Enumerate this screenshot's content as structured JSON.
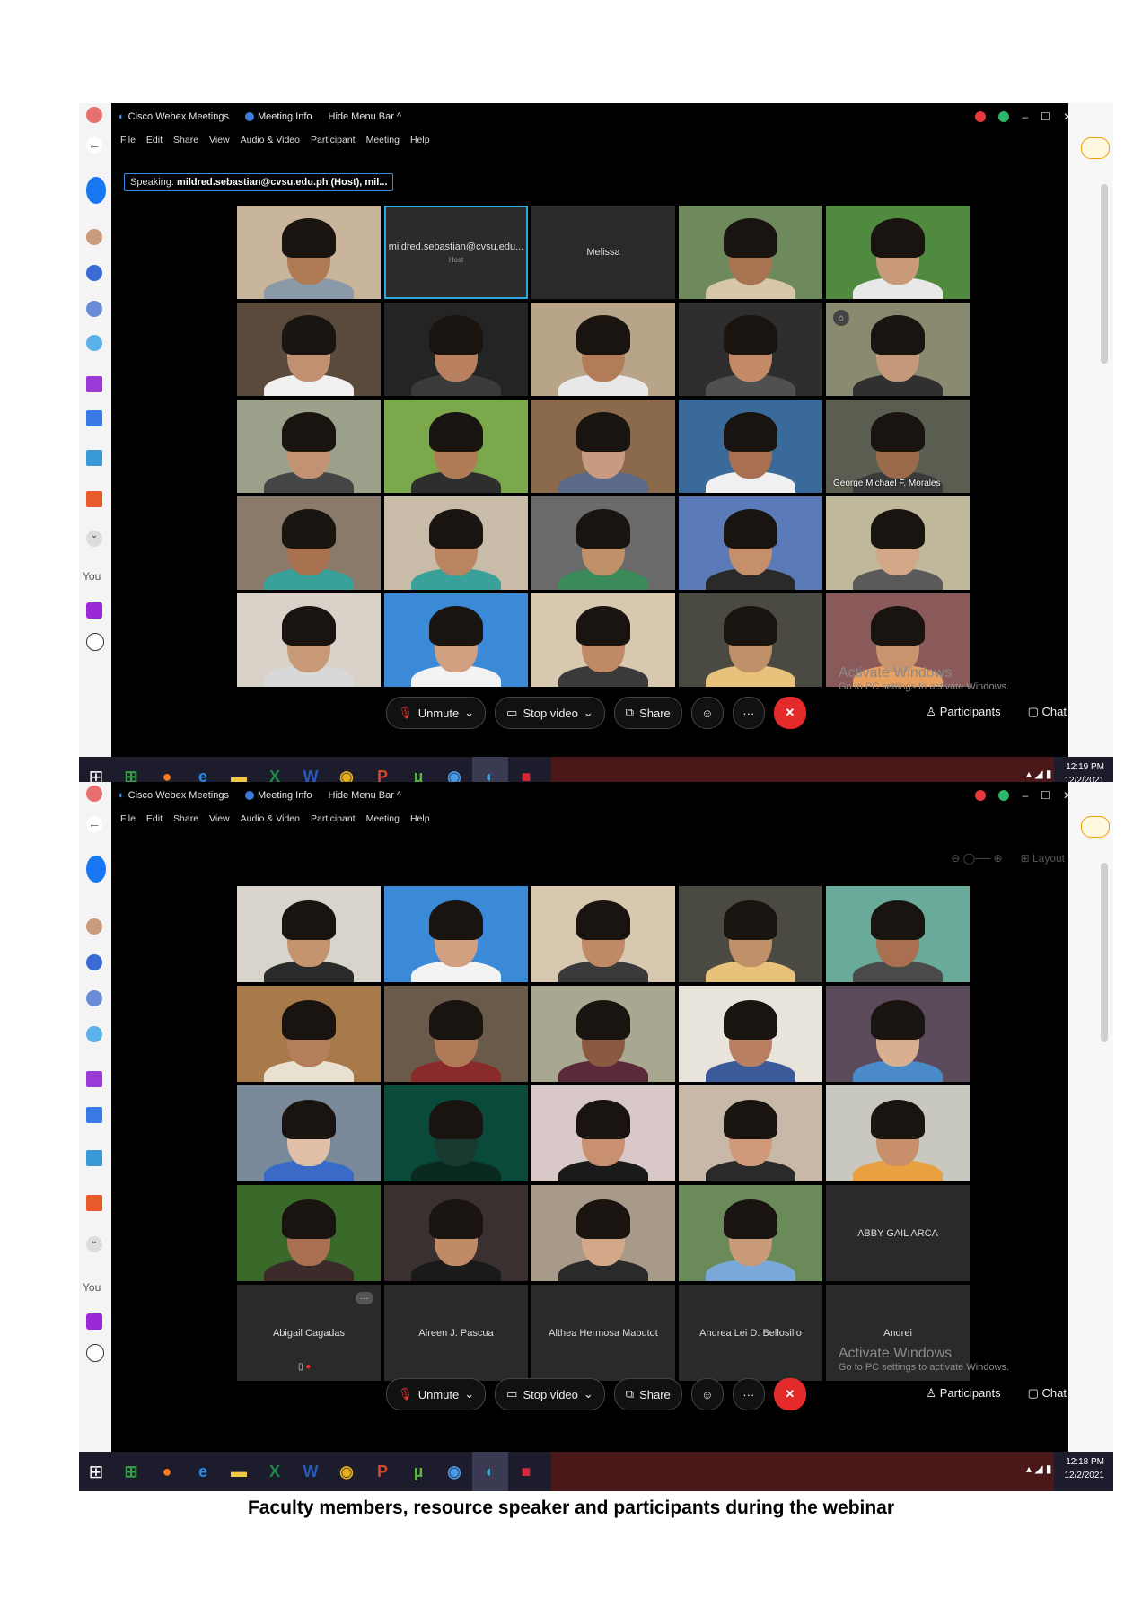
{
  "screens": [
    {
      "id": "top",
      "window_title": "Cisco Webex Meetings",
      "meeting_info": "Meeting Info",
      "hide_menu": "Hide Menu Bar ^",
      "menus": [
        "File",
        "Edit",
        "Share",
        "View",
        "Audio & Video",
        "Participant",
        "Meeting",
        "Help"
      ],
      "speaking_label": "Speaking:",
      "speaking_value": "mildred.sebastian@cvsu.edu.ph (Host), mil...",
      "tiles": [
        {
          "type": "video",
          "bg": "#c9b59b",
          "skin": "#b07a55",
          "shirt": "#8a9aa8"
        },
        {
          "type": "name",
          "name": "mildred.sebastian@cvsu.edu...",
          "sub": "Host",
          "highlight": true
        },
        {
          "type": "name",
          "name": "Melissa"
        },
        {
          "type": "video",
          "bg": "#6e8a5c",
          "skin": "#a87350",
          "shirt": "#d8c6a8"
        },
        {
          "type": "video",
          "bg": "#4f8a3e",
          "skin": "#c89a78",
          "shirt": "#e8e8e8"
        },
        {
          "type": "video",
          "bg": "#5a4a3c",
          "skin": "#c09070",
          "shirt": "#f0f0f0"
        },
        {
          "type": "video",
          "bg": "#242424",
          "skin": "#b98060",
          "shirt": "#3a3a3a"
        },
        {
          "type": "video",
          "bg": "#b8a488",
          "skin": "#b27c58",
          "shirt": "#e8e8e8"
        },
        {
          "type": "video",
          "bg": "#2e2e2e",
          "skin": "#c28a66",
          "shirt": "#505050"
        },
        {
          "type": "video",
          "bg": "#8a8a70",
          "skin": "#c4987a",
          "shirt": "#303030",
          "badge": "⌂"
        },
        {
          "type": "video",
          "bg": "#9aa08a",
          "skin": "#c29272",
          "shirt": "#454545"
        },
        {
          "type": "video",
          "bg": "#7aa84a",
          "skin": "#b07a55",
          "shirt": "#2e2e2e"
        },
        {
          "type": "video",
          "bg": "#8a6a4a",
          "skin": "#c89a80",
          "shirt": "#5a6a88"
        },
        {
          "type": "video",
          "bg": "#3a6a9a",
          "skin": "#a87050",
          "shirt": "#f0f0f0"
        },
        {
          "type": "video",
          "bg": "#5a5e50",
          "skin": "#9a6a4a",
          "shirt": "#3a3a3a",
          "label": "George Michael F. Morales"
        },
        {
          "type": "video",
          "bg": "#8a7a6a",
          "skin": "#a87250",
          "shirt": "#3aa09a"
        },
        {
          "type": "video",
          "bg": "#c8bca8",
          "skin": "#b88462",
          "shirt": "#3aa09a"
        },
        {
          "type": "video",
          "bg": "#6a6a6a",
          "skin": "#c09068",
          "shirt": "#3a8a5a"
        },
        {
          "type": "video",
          "bg": "#5a7ab8",
          "skin": "#c4906c",
          "shirt": "#2a2a2a"
        },
        {
          "type": "video",
          "bg": "#c0b89a",
          "skin": "#d2a888",
          "shirt": "#5a5a5a"
        },
        {
          "type": "video",
          "bg": "#d8d2c8",
          "skin": "#c89a78",
          "shirt": "#d8d8d8"
        },
        {
          "type": "video",
          "bg": "#3a8ad8",
          "skin": "#d0a080",
          "shirt": "#f2f2f2"
        },
        {
          "type": "video",
          "bg": "#d8c8b0",
          "skin": "#c08a66",
          "shirt": "#3a3a3a"
        },
        {
          "type": "video",
          "bg": "#4a4a42",
          "skin": "#c09068",
          "shirt": "#e8c27a"
        },
        {
          "type": "video",
          "bg": "#8a5a5a",
          "skin": "#c8946e",
          "shirt": "#e8a060"
        }
      ],
      "toolbar": {
        "unmute": "Unmute",
        "stop_video": "Stop video",
        "share": "Share",
        "more": "···",
        "end": "✕",
        "participants": "Participants",
        "chat": "Chat"
      },
      "activate_title": "Activate Windows",
      "activate_sub": "Go to PC settings to activate Windows.",
      "clock_time": "12:19 PM",
      "clock_date": "12/2/2021"
    },
    {
      "id": "bottom",
      "window_title": "Cisco Webex Meetings",
      "meeting_info": "Meeting Info",
      "hide_menu": "Hide Menu Bar ^",
      "menus": [
        "File",
        "Edit",
        "Share",
        "View",
        "Audio & Video",
        "Participant",
        "Meeting",
        "Help"
      ],
      "layout_label": "Layout",
      "tiles": [
        {
          "type": "video",
          "bg": "#d8d4cc",
          "skin": "#c4946e",
          "shirt": "#2a2a2a"
        },
        {
          "type": "video",
          "bg": "#3a8ad8",
          "skin": "#d0a080",
          "shirt": "#f2f2f2"
        },
        {
          "type": "video",
          "bg": "#d8c8b0",
          "skin": "#c08a66",
          "shirt": "#3a3a3a"
        },
        {
          "type": "video",
          "bg": "#4a4a42",
          "skin": "#c09068",
          "shirt": "#e8c27a"
        },
        {
          "type": "video",
          "bg": "#6aaa9a",
          "skin": "#a87050",
          "shirt": "#4a4a4a"
        },
        {
          "type": "video",
          "bg": "#a87a4a",
          "skin": "#b47e5a",
          "shirt": "#e8e0d0"
        },
        {
          "type": "video",
          "bg": "#6a5a4a",
          "skin": "#b07a58",
          "shirt": "#8a2a2a"
        },
        {
          "type": "video",
          "bg": "#a8a890",
          "skin": "#8a5a40",
          "shirt": "#5a2a3a"
        },
        {
          "type": "video",
          "bg": "#e8e4dc",
          "skin": "#b88060",
          "shirt": "#3a5a9a"
        },
        {
          "type": "video",
          "bg": "#5a4a5a",
          "skin": "#d8b090",
          "shirt": "#4a8ac8"
        },
        {
          "type": "video",
          "bg": "#7a8a9a",
          "skin": "#e0c0a8",
          "shirt": "#3a6ac8"
        },
        {
          "type": "video",
          "bg": "#0a4a3a",
          "skin": "#1a3a30",
          "shirt": "#0a2a20"
        },
        {
          "type": "video",
          "bg": "#d8c8c8",
          "skin": "#c89070",
          "shirt": "#1a1a1a"
        },
        {
          "type": "video",
          "bg": "#c8b8a8",
          "skin": "#d09a7a",
          "shirt": "#2a2a2a"
        },
        {
          "type": "video",
          "bg": "#c8c8c0",
          "skin": "#c8906a",
          "shirt": "#e8a040"
        },
        {
          "type": "video",
          "bg": "#3a6a2a",
          "skin": "#a87050",
          "shirt": "#3a2a2a"
        },
        {
          "type": "video",
          "bg": "#3a3030",
          "skin": "#c08a66",
          "shirt": "#1a1a1a"
        },
        {
          "type": "video",
          "bg": "#a89a88",
          "skin": "#d2a888",
          "shirt": "#2a2a2a"
        },
        {
          "type": "video",
          "bg": "#6a8a5a",
          "skin": "#c89a78",
          "shirt": "#7aa8d8"
        },
        {
          "type": "name",
          "name": "ABBY GAIL ARCA"
        },
        {
          "type": "name",
          "name": "Abigail Cagadas",
          "more": "···",
          "mic": true
        },
        {
          "type": "name",
          "name": "Aireen J. Pascua"
        },
        {
          "type": "name",
          "name": "Althea Hermosa Mabutot"
        },
        {
          "type": "name",
          "name": "Andrea Lei D. Bellosillo"
        },
        {
          "type": "name",
          "name": "Andrei"
        }
      ],
      "toolbar": {
        "unmute": "Unmute",
        "stop_video": "Stop video",
        "share": "Share",
        "more": "···",
        "end": "✕",
        "participants": "Participants",
        "chat": "Chat"
      },
      "activate_title": "Activate Windows",
      "activate_sub": "Go to PC settings to activate Windows.",
      "clock_time": "12:18 PM",
      "clock_date": "12/2/2021"
    }
  ],
  "browser_partial_text": "You",
  "taskbar_apps": [
    {
      "icon": "store-icon",
      "glyph": "⊞",
      "color": "#3aa04a"
    },
    {
      "icon": "firefox-icon",
      "glyph": "●",
      "color": "#ff7a1a"
    },
    {
      "icon": "ie-icon",
      "glyph": "e",
      "color": "#2a8ae8"
    },
    {
      "icon": "explorer-icon",
      "glyph": "▬",
      "color": "#f0c848"
    },
    {
      "icon": "excel-icon",
      "glyph": "X",
      "color": "#1f8a4a"
    },
    {
      "icon": "word-icon",
      "glyph": "W",
      "color": "#2a5ab8"
    },
    {
      "icon": "chrome-icon",
      "glyph": "◉",
      "color": "#e8b020"
    },
    {
      "icon": "powerpoint-icon",
      "glyph": "P",
      "color": "#d04a2a"
    },
    {
      "icon": "utorrent-icon",
      "glyph": "µ",
      "color": "#5ab83a"
    },
    {
      "icon": "chrome-2-icon",
      "glyph": "◉",
      "color": "#4a9ae8"
    },
    {
      "icon": "webex-icon",
      "glyph": "◐",
      "color": "#2ea8e0"
    },
    {
      "icon": "app-red-icon",
      "glyph": "■",
      "color": "#d02a3a"
    }
  ],
  "caption": "Faculty members, resource speaker and participants during the webinar"
}
